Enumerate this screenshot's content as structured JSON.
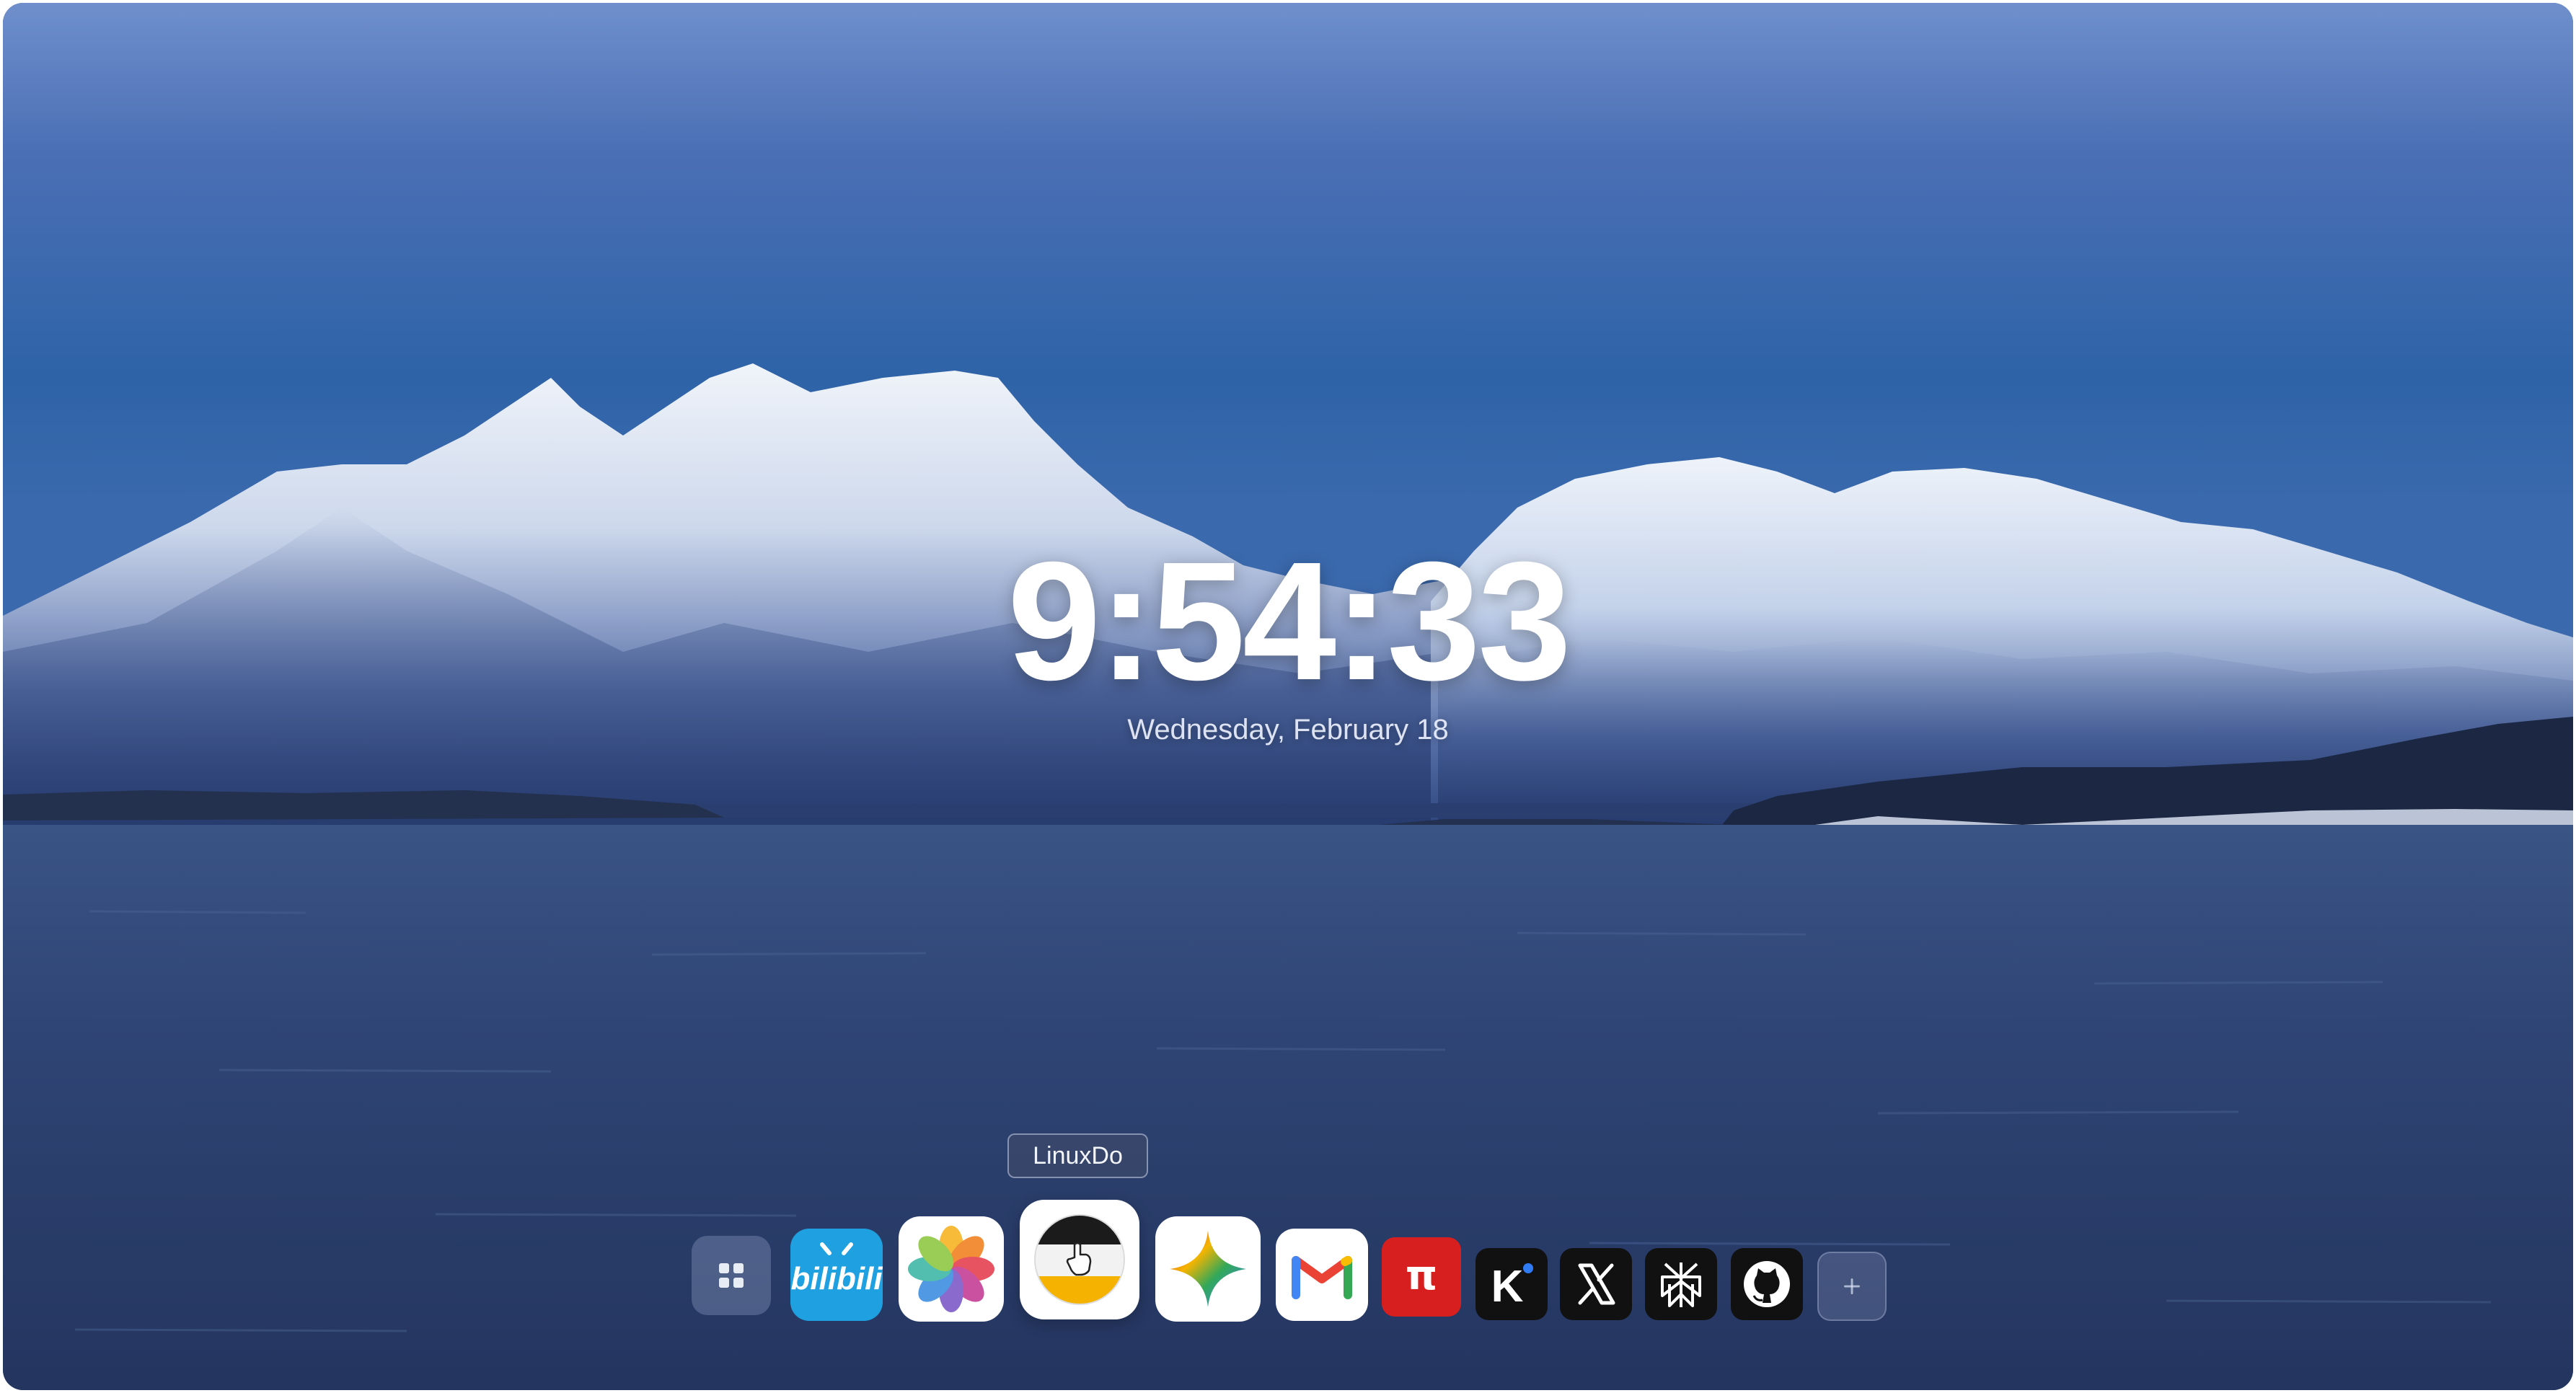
{
  "clock": {
    "time": "9:54:33",
    "date": "Wednesday, February 18"
  },
  "tooltip": {
    "label": "LinuxDo"
  },
  "dock": {
    "items": [
      {
        "name": "apps-grid",
        "icon": "grid-icon"
      },
      {
        "name": "bilibili",
        "icon": "bilibili-icon",
        "text": "bilibili"
      },
      {
        "name": "photos",
        "icon": "photos-icon"
      },
      {
        "name": "linuxdo",
        "icon": "linuxdo-icon"
      },
      {
        "name": "gemini",
        "icon": "gemini-sparkle-icon"
      },
      {
        "name": "gmail",
        "icon": "gmail-icon"
      },
      {
        "name": "pi",
        "icon": "pi-icon",
        "text": "π"
      },
      {
        "name": "kimi",
        "icon": "kimi-icon",
        "text": "K"
      },
      {
        "name": "x",
        "icon": "x-logo-icon"
      },
      {
        "name": "perplexity",
        "icon": "perplexity-icon"
      },
      {
        "name": "github",
        "icon": "github-icon"
      },
      {
        "name": "add",
        "icon": "plus-icon"
      }
    ]
  },
  "colors": {
    "sky": "#3a5ea8",
    "mountain_snow": "#e6ecf6",
    "sea": "#2d4474",
    "bilibili": "#1fa0e0",
    "pi": "#d71f1f",
    "dark_tile": "#111111"
  }
}
